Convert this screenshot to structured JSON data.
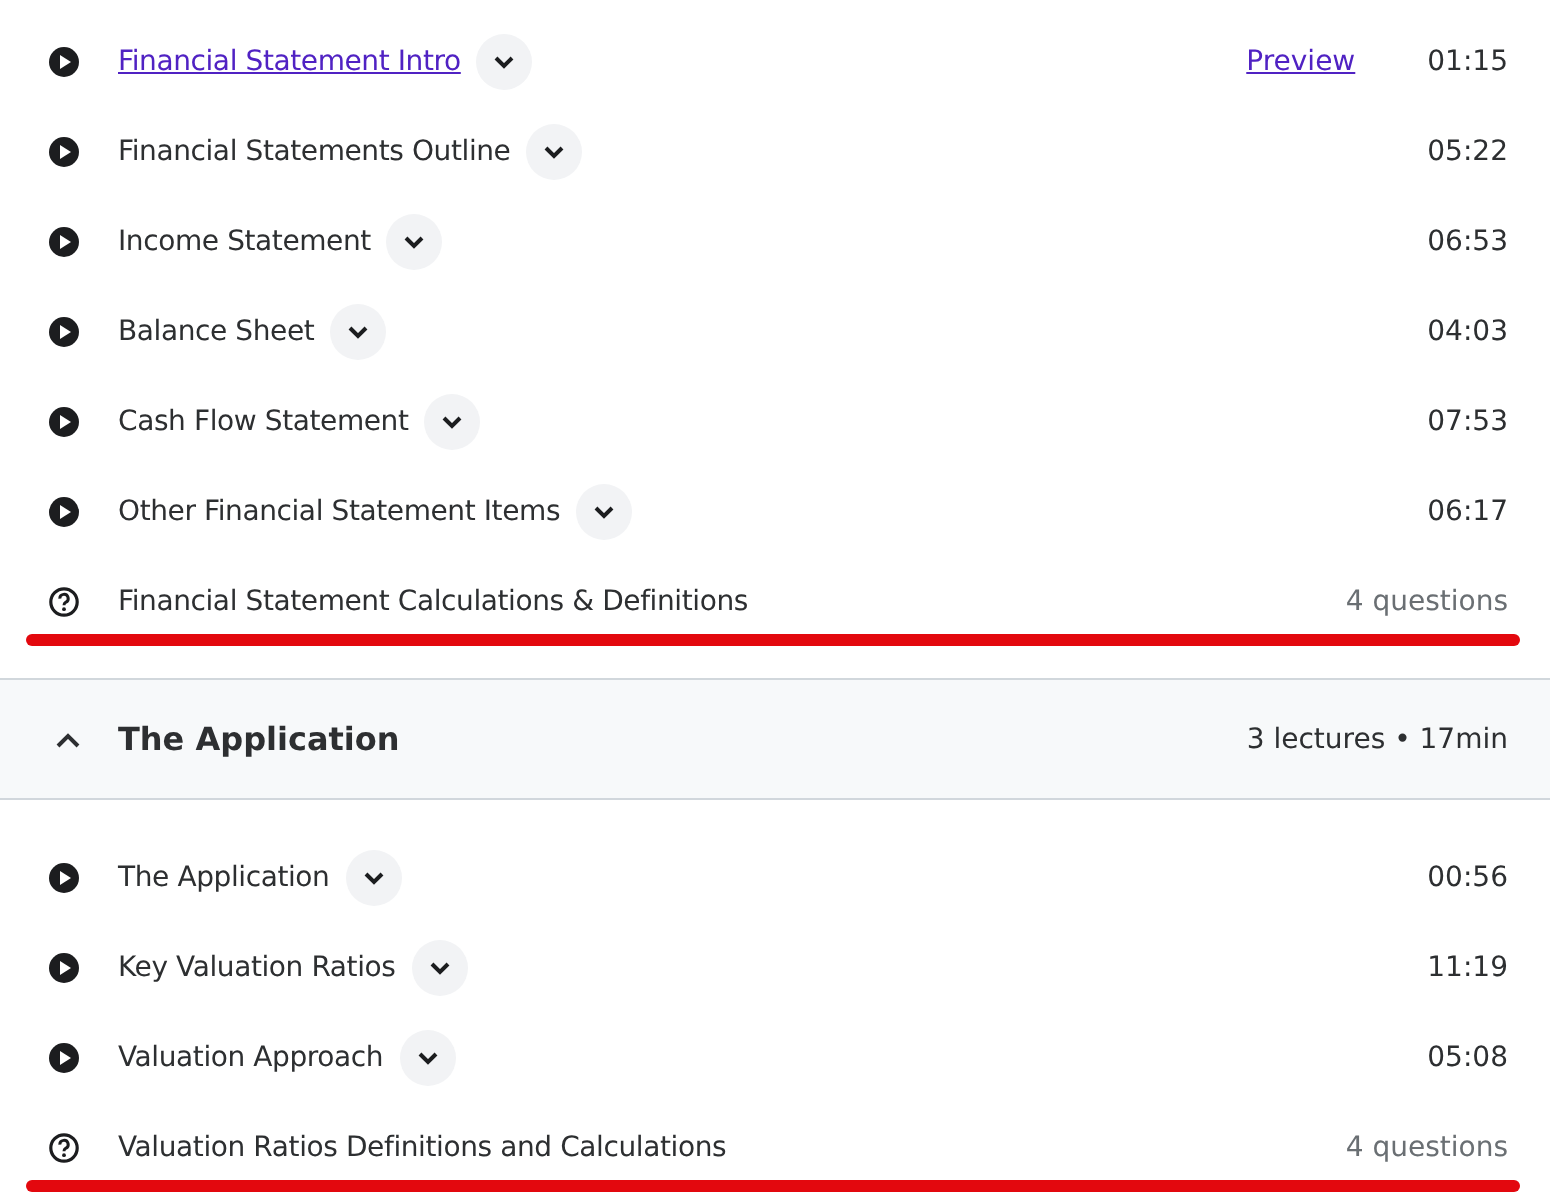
{
  "sections": [
    {
      "items": [
        {
          "kind": "video",
          "title": "Financial Statement Intro",
          "link": true,
          "preview": "Preview",
          "expandable": true,
          "meta": "01:15",
          "highlighted": false
        },
        {
          "kind": "video",
          "title": "Financial Statements Outline",
          "link": false,
          "expandable": true,
          "meta": "05:22",
          "highlighted": false
        },
        {
          "kind": "video",
          "title": "Income Statement",
          "link": false,
          "expandable": true,
          "meta": "06:53",
          "highlighted": false
        },
        {
          "kind": "video",
          "title": "Balance Sheet",
          "link": false,
          "expandable": true,
          "meta": "04:03",
          "highlighted": false
        },
        {
          "kind": "video",
          "title": "Cash Flow Statement",
          "link": false,
          "expandable": true,
          "meta": "07:53",
          "highlighted": false
        },
        {
          "kind": "video",
          "title": "Other Financial Statement Items",
          "link": false,
          "expandable": true,
          "meta": "06:17",
          "highlighted": false
        },
        {
          "kind": "quiz",
          "title": "Financial Statement Calculations & Definitions",
          "link": false,
          "expandable": false,
          "meta": "4 questions",
          "highlighted": true
        }
      ]
    },
    {
      "title": "The Application",
      "expanded": true,
      "summary": "3 lectures • 17min",
      "items": [
        {
          "kind": "video",
          "title": "The Application",
          "link": false,
          "expandable": true,
          "meta": "00:56",
          "highlighted": false
        },
        {
          "kind": "video",
          "title": "Key Valuation Ratios",
          "link": false,
          "expandable": true,
          "meta": "11:19",
          "highlighted": false
        },
        {
          "kind": "video",
          "title": "Valuation Approach",
          "link": false,
          "expandable": true,
          "meta": "05:08",
          "highlighted": false
        },
        {
          "kind": "quiz",
          "title": "Valuation Ratios Definitions and Calculations",
          "link": false,
          "expandable": false,
          "meta": "4 questions",
          "highlighted": true
        }
      ]
    }
  ]
}
